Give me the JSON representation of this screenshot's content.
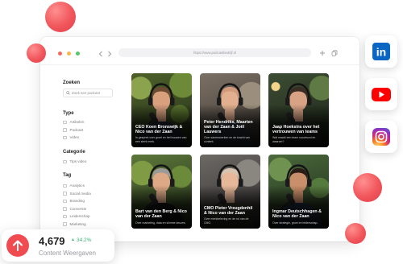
{
  "browser": {
    "url": "https://www.podcastbedrijf.nl",
    "window_dot_colors": [
      "#f26a5e",
      "#f7b84b",
      "#5cc46a"
    ],
    "icons": [
      "chevron-left-icon",
      "chevron-right-icon",
      "plus-icon",
      "copy-icon"
    ]
  },
  "sidebar": {
    "search_label": "Zoeken",
    "search_placeholder": "Zoek een podcast",
    "type_label": "Type",
    "type_options": [
      "Artikelen",
      "Podcast",
      "Video"
    ],
    "category_label": "Categorie",
    "category_options": [
      "Tips video"
    ],
    "tag_label": "Tag",
    "tag_options": [
      "Analytics",
      "Social media",
      "Branding",
      "Conversie",
      "Leiderschap",
      "Marketing"
    ]
  },
  "cards": [
    {
      "title": "CEO Koen Bronswijk & Nico van der Zaan",
      "subtitle": "In gesprek over groei en het bouwen van een sterk merk."
    },
    {
      "title": "Peter Hendriks, Maarten van der Zaan & Joël Lauwers",
      "subtitle": "Over samenwerken en de kracht van content."
    },
    {
      "title": "Jaap Hoekstra over het vertrouwen van teams",
      "subtitle": "Wat maakt een team succesvol en waarom?"
    },
    {
      "title": "Bart van den Berg & Nico van der Zaan",
      "subtitle": "Over marketing, data en slimme keuzes."
    },
    {
      "title": "CMO Pieter Vreugdenhil & Nico van der Zaan",
      "subtitle": "Over merkbeleving en de rol van de CMO."
    },
    {
      "title": "Ingmar Deutschhagen & Nico van der Zaan",
      "subtitle": "Over strategie, groei en leiderschap."
    }
  ],
  "social": [
    {
      "icon": "linkedin-icon",
      "color": "#0a66c2",
      "logo_text": "in"
    },
    {
      "icon": "youtube-icon",
      "color": "#ff0000"
    },
    {
      "icon": "instagram-icon",
      "color": "#d62976"
    }
  ],
  "stats": {
    "icon": "arrow-up-icon",
    "value": "4,679",
    "change": "34.2%",
    "label": "Content Weergaven"
  },
  "colors": {
    "accent": "#ef4b51",
    "positive": "#3bb273"
  }
}
